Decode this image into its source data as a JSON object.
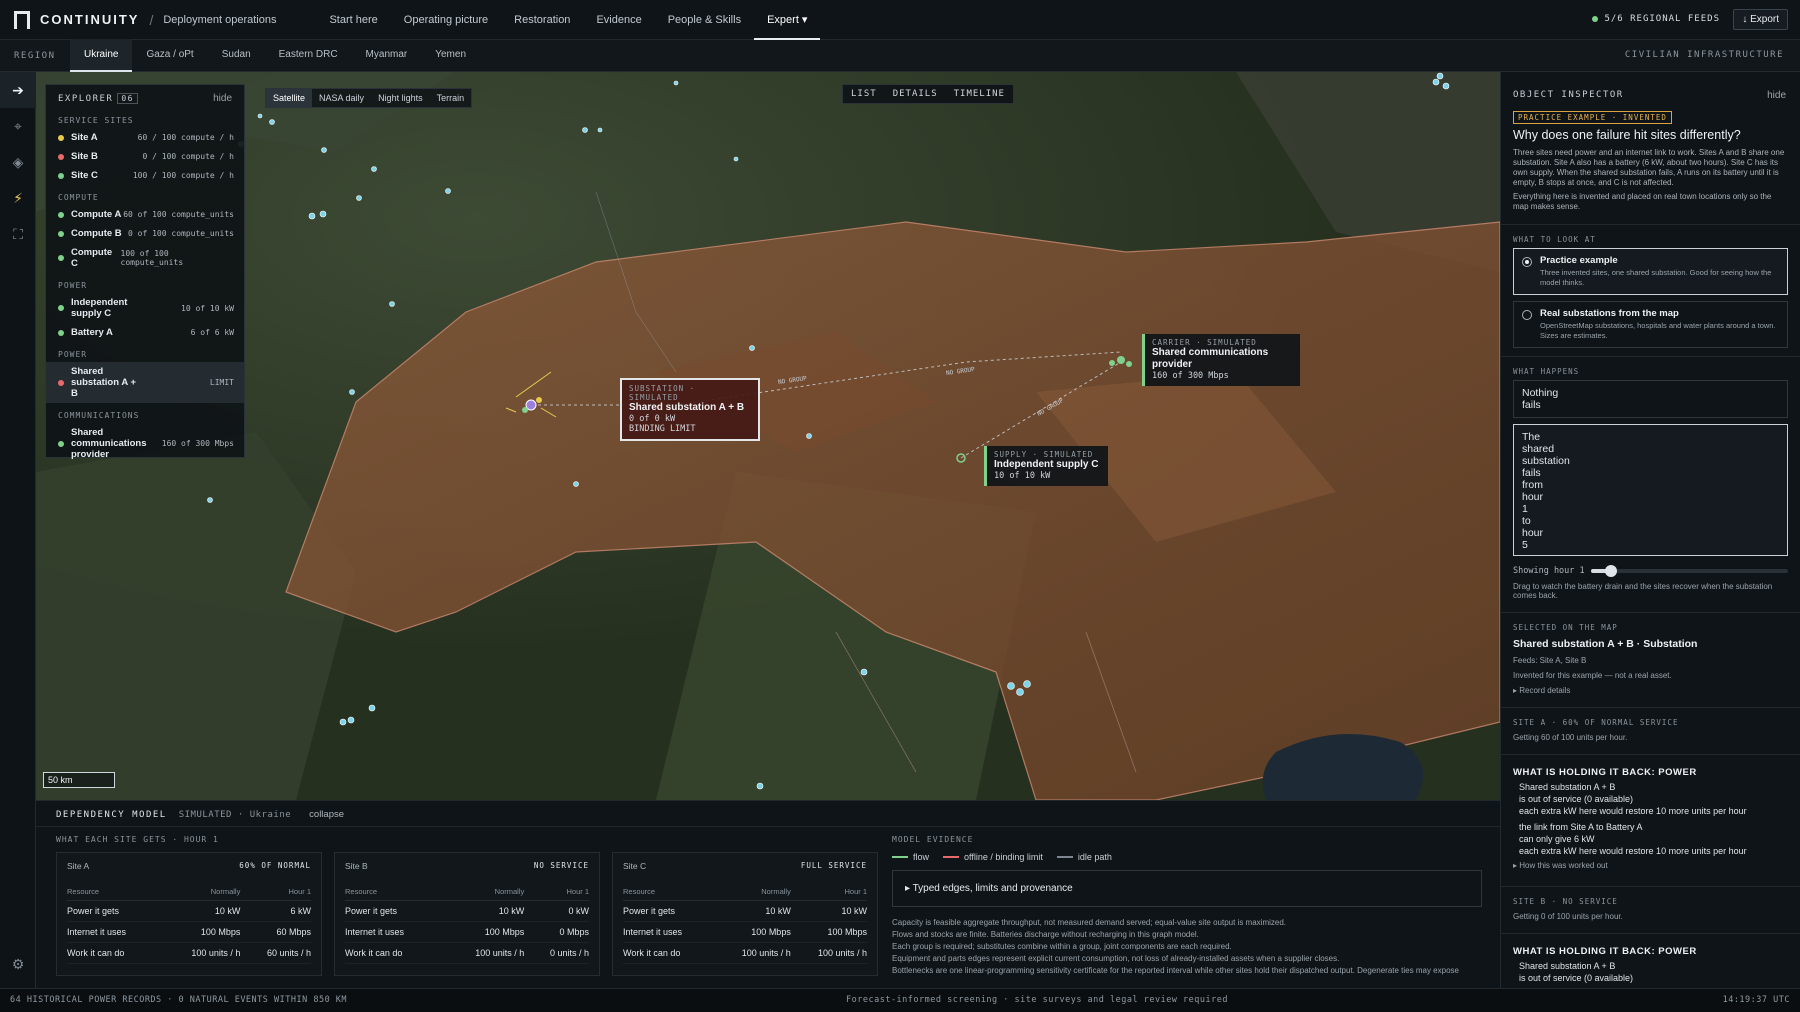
{
  "topbar": {
    "app_name": "CONTINUITY",
    "breadcrumb": "Deployment operations",
    "nav": [
      "Start here",
      "Operating picture",
      "Restoration",
      "Evidence",
      "People & Skills",
      "Expert ▾"
    ],
    "active_nav": "Expert ▾",
    "feeds": "5/6 REGIONAL FEEDS",
    "export_label": "↓ Export"
  },
  "regionbar": {
    "label": "REGION",
    "tabs": [
      "Ukraine",
      "Gaza / oPt",
      "Sudan",
      "Eastern DRC",
      "Myanmar",
      "Yemen"
    ],
    "active": "Ukraine",
    "right_label": "CIVILIAN INFRASTRUCTURE"
  },
  "explorer": {
    "title": "EXPLORER",
    "count": "06",
    "hide": "hide",
    "groups": [
      {
        "label": "SERVICE SITES",
        "items": [
          {
            "name": "Site A",
            "value": "60 / 100 compute / h",
            "color": "#e9c94f"
          },
          {
            "name": "Site B",
            "value": "0 / 100 compute / h",
            "color": "#e86a6a"
          },
          {
            "name": "Site C",
            "value": "100 / 100 compute / h",
            "color": "#7fd18c"
          }
        ]
      },
      {
        "label": "COMPUTE",
        "items": [
          {
            "name": "Compute A",
            "value": "60 of 100 compute_units",
            "color": "#7fd18c"
          },
          {
            "name": "Compute B",
            "value": "0 of 100 compute_units",
            "color": "#7fd18c"
          },
          {
            "name": "Compute C",
            "value": "100 of 100 compute_units",
            "color": "#7fd18c"
          }
        ]
      },
      {
        "label": "POWER",
        "items": [
          {
            "name": "Independent supply C",
            "value": "10 of 10 kW",
            "color": "#7fd18c"
          },
          {
            "name": "Battery A",
            "value": "6 of 6 kW",
            "color": "#7fd18c"
          }
        ]
      },
      {
        "label": "POWER",
        "items": [
          {
            "name": "Shared substation A + B",
            "value": "LIMIT",
            "color": "#e86a6a",
            "selected": true
          }
        ]
      },
      {
        "label": "COMMUNICATIONS",
        "items": [
          {
            "name": "Shared communications provider",
            "value": "160 of 300 Mbps",
            "color": "#7fd18c"
          }
        ]
      }
    ]
  },
  "map": {
    "layers": [
      "Satellite",
      "NASA daily",
      "Night lights",
      "Terrain"
    ],
    "active_layer": "Satellite",
    "view_tabs": [
      "LIST",
      "DETAILS",
      "TIMELINE"
    ],
    "scale": "50 km",
    "edge_labels": [
      "NO GROUP",
      "NO GROUP",
      "NO GROUP"
    ],
    "labels": {
      "substation": {
        "kind": "SUBSTATION · SIMULATED",
        "name": "Shared substation A + B",
        "value": "0 of 0 kW",
        "extra": "BINDING LIMIT"
      },
      "carrier": {
        "kind": "CARRIER · SIMULATED",
        "name": "Shared communications provider",
        "value": "160 of 300 Mbps"
      },
      "supply": {
        "kind": "SUPPLY · SIMULATED",
        "name": "Independent supply C",
        "value": "10 of 10 kW"
      }
    }
  },
  "inspector": {
    "title": "OBJECT INSPECTOR",
    "hide": "hide",
    "badge": "PRACTICE EXAMPLE · INVENTED",
    "question": "Why does one failure hit sites differently?",
    "para1": "Three sites need power and an internet link to work. Sites A and B share one substation. Site A also has a battery (6 kW, about two hours). Site C has its own supply. When the shared substation fails, A runs on its battery until it is empty, B stops at once, and C is not affected.",
    "para2": "Everything here is invented and placed on real town locations only so the map makes sense.",
    "look_label": "WHAT TO LOOK AT",
    "options": [
      {
        "title": "Practice example",
        "desc": "Three invented sites, one shared substation. Good for seeing how the model thinks.",
        "selected": true
      },
      {
        "title": "Real substations from the map",
        "desc": "OpenStreetMap substations, hospitals and water plants around a town. Sizes are estimates.",
        "selected": false
      }
    ],
    "happens_label": "WHAT HAPPENS",
    "happen_a": [
      "Nothing",
      "fails"
    ],
    "happen_b": [
      "The",
      "shared",
      "substation",
      "fails",
      "from",
      "hour",
      "1",
      "to",
      "hour",
      "5"
    ],
    "slider_label": "Showing hour",
    "slider_value": "1",
    "slider_fraction": 0.1,
    "slider_help": "Drag to watch the battery drain and the sites recover when the substation comes back.",
    "selected_label": "SELECTED ON THE MAP",
    "selected_title": "Shared substation A + B · Substation",
    "feeds": "Feeds: Site A, Site B",
    "invented": "Invented for this example — not a real asset.",
    "record": "▸ Record details",
    "siteA_label": "SITE A · 60% OF NORMAL SERVICE",
    "siteA_text": "Getting 60 of 100 units per hour.",
    "hold_title": "WHAT IS HOLDING IT BACK: POWER",
    "holdA": [
      "Shared substation A + B",
      "is out of service (0 available)",
      "each extra kW here would restore 10 more units per hour",
      "the link from Site A to Battery A",
      "can only give 6 kW",
      "each extra kW here would restore 10 more units per hour"
    ],
    "worked": "▸ How this was worked out",
    "siteB_label": "SITE B · NO SERVICE",
    "siteB_text": "Getting 0 of 100 units per hour.",
    "holdB": [
      "Shared substation A + B",
      "is out of service (0 available)"
    ]
  },
  "bottom": {
    "title": "DEPENDENCY MODEL",
    "sub": "SIMULATED · Ukraine",
    "collapse": "collapse",
    "sites_label": "WHAT EACH SITE GETS · HOUR 1",
    "col_headers": [
      "Resource",
      "Normally",
      "Hour 1"
    ],
    "sites": [
      {
        "name": "Site A",
        "status": "60% OF NORMAL",
        "rows": [
          [
            "Power it gets",
            "10 kW",
            "6 kW"
          ],
          [
            "Internet it uses",
            "100 Mbps",
            "60 Mbps"
          ],
          [
            "Work it can do",
            "100 units / h",
            "60 units / h"
          ]
        ]
      },
      {
        "name": "Site B",
        "status": "NO SERVICE",
        "rows": [
          [
            "Power it gets",
            "10 kW",
            "0 kW"
          ],
          [
            "Internet it uses",
            "100 Mbps",
            "0 Mbps"
          ],
          [
            "Work it can do",
            "100 units / h",
            "0 units / h"
          ]
        ]
      },
      {
        "name": "Site C",
        "status": "FULL SERVICE",
        "rows": [
          [
            "Power it gets",
            "10 kW",
            "10 kW"
          ],
          [
            "Internet it uses",
            "100 Mbps",
            "100 Mbps"
          ],
          [
            "Work it can do",
            "100 units / h",
            "100 units / h"
          ]
        ]
      }
    ],
    "evidence_label": "MODEL EVIDENCE",
    "legend": [
      {
        "label": "flow",
        "color": "#7fd18c"
      },
      {
        "label": "offline / binding limit",
        "color": "#e86a6a"
      },
      {
        "label": "idle path",
        "color": "#7d868e"
      }
    ],
    "evidence_toggle": "▸ Typed edges, limits and provenance",
    "evidence_lines": [
      "Capacity is feasible aggregate throughput, not measured demand served; equal-value site output is maximized.",
      "Flows and stocks are finite. Batteries discharge without recharging in this graph model.",
      "Each group is required; substitutes combine within a group, joint components are each required.",
      "Equipment and parts edges represent explicit current consumption, not loss of already-installed assets when a supplier closes.",
      "Bottlenecks are one linear-programming sensitivity certificate for the reported interval while other sites hold their dispatched output. Degenerate ties may expose"
    ]
  },
  "statusbar": {
    "left": "64 HISTORICAL POWER RECORDS · 0 NATURAL EVENTS WITHIN 850 KM",
    "center": "Forecast-informed screening · site surveys and legal review required",
    "right": "14:19:37 UTC"
  }
}
